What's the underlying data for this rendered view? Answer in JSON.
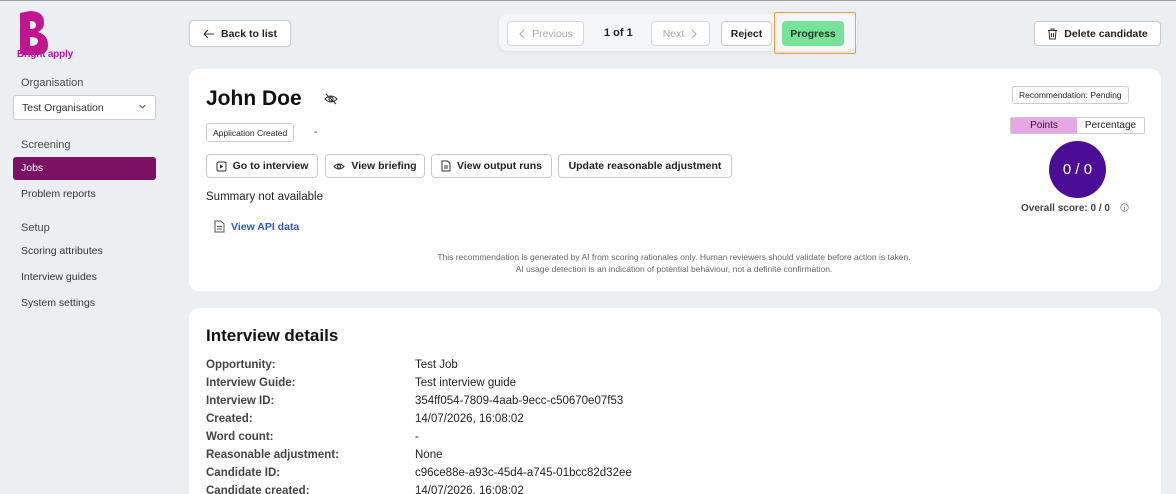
{
  "brand": {
    "name": "Bright apply",
    "color": "#b5179e"
  },
  "sidebar": {
    "organisation_heading": "Organisation",
    "organisation_value": "Test Organisation",
    "screening_heading": "Screening",
    "screening_items": [
      {
        "label": "Jobs",
        "active": true
      },
      {
        "label": "Problem reports",
        "active": false
      }
    ],
    "setup_heading": "Setup",
    "setup_items": [
      {
        "label": "Scoring attributes"
      },
      {
        "label": "Interview guides"
      },
      {
        "label": "System settings"
      }
    ]
  },
  "toolbar": {
    "back_label": "Back to list",
    "previous_label": "Previous",
    "page_count": "1 of 1",
    "next_label": "Next",
    "reject_label": "Reject",
    "progress_label": "Progress",
    "delete_label": "Delete candidate"
  },
  "candidate": {
    "name": "John Doe",
    "status": "Application Created",
    "status_detail": "-",
    "actions": {
      "go_to_interview": "Go to interview",
      "view_briefing": "View briefing",
      "view_output_runs": "View output runs",
      "update_adjustment": "Update reasonable adjustment"
    },
    "summary": "Summary not available",
    "api_link": "View API data",
    "disclaimer_line1": "This recommendation is generated by AI from scoring rationales only. Human reviewers should validate before action is taken.",
    "disclaimer_line2": "AI usage detection is an indication of potential behaviour, not a definite confirmation.",
    "recommendation": "Recommendation: Pending",
    "score_toggle": {
      "points": "Points",
      "percentage": "Percentage",
      "selected": "Points"
    },
    "score": "0 / 0",
    "overall_score": "Overall score: 0 / 0"
  },
  "interview_details": {
    "title": "Interview details",
    "rows": [
      {
        "label": "Opportunity:",
        "value": "Test Job"
      },
      {
        "label": "Interview Guide:",
        "value": "Test interview guide"
      },
      {
        "label": "Interview ID:",
        "value": "354ff054-7809-4aab-9ecc-c50670e07f53"
      },
      {
        "label": "Created:",
        "value": "14/07/2026, 16:08:02"
      },
      {
        "label": "Word count:",
        "value": "-"
      },
      {
        "label": "Reasonable adjustment:",
        "value": "None"
      },
      {
        "label": "Candidate ID:",
        "value": "c96ce88e-a93c-45d4-a745-01bcc82d32ee"
      },
      {
        "label": "Candidate created:",
        "value": "14/07/2026, 16:08:02"
      }
    ]
  },
  "colors": {
    "accent": "#7b1163",
    "progress": "#79e29a",
    "score_circle": "#4b0c96",
    "toggle_selected": "#e7a7e6",
    "link": "#2c59c9"
  }
}
